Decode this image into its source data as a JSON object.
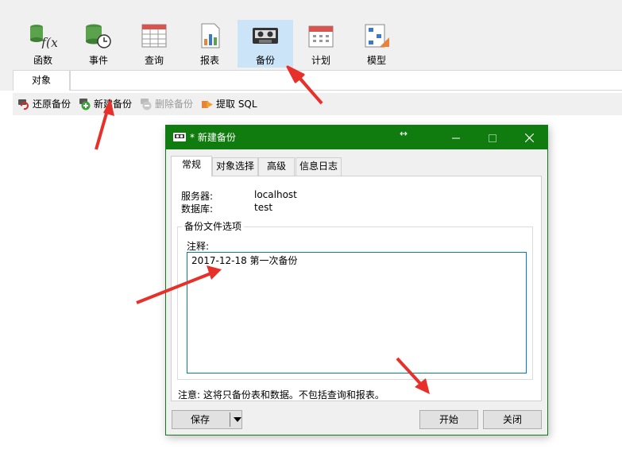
{
  "toolbar": {
    "items": [
      {
        "label": "函数",
        "icon": "function-icon"
      },
      {
        "label": "事件",
        "icon": "event-icon"
      },
      {
        "label": "查询",
        "icon": "query-icon"
      },
      {
        "label": "报表",
        "icon": "report-icon"
      },
      {
        "label": "备份",
        "icon": "backup-icon",
        "active": true
      },
      {
        "label": "计划",
        "icon": "schedule-icon"
      },
      {
        "label": "模型",
        "icon": "model-icon"
      }
    ]
  },
  "object_tab": {
    "label": "对象"
  },
  "actions": {
    "restore": "还原备份",
    "new_backup": "新建备份",
    "delete_backup": "删除备份",
    "extract_sql": "提取 SQL"
  },
  "dialog": {
    "title": "* 新建备份",
    "tabs": [
      "常规",
      "对象选择",
      "高级",
      "信息日志"
    ],
    "server_label": "服务器:",
    "server_value": "localhost",
    "database_label": "数据库:",
    "database_value": "test",
    "group_title": "备份文件选项",
    "comment_label": "注释:",
    "comment_value": "2017-12-18 第一次备份",
    "note": "注意: 这将只备份表和数据。不包括查询和报表。",
    "save_button": "保存",
    "start_button": "开始",
    "close_button": "关闭"
  },
  "colors": {
    "titlebar": "#107c10",
    "active_toolbar": "#cce4f7",
    "annotation_arrow": "#e8302a",
    "focus_border": "#0078d7"
  }
}
